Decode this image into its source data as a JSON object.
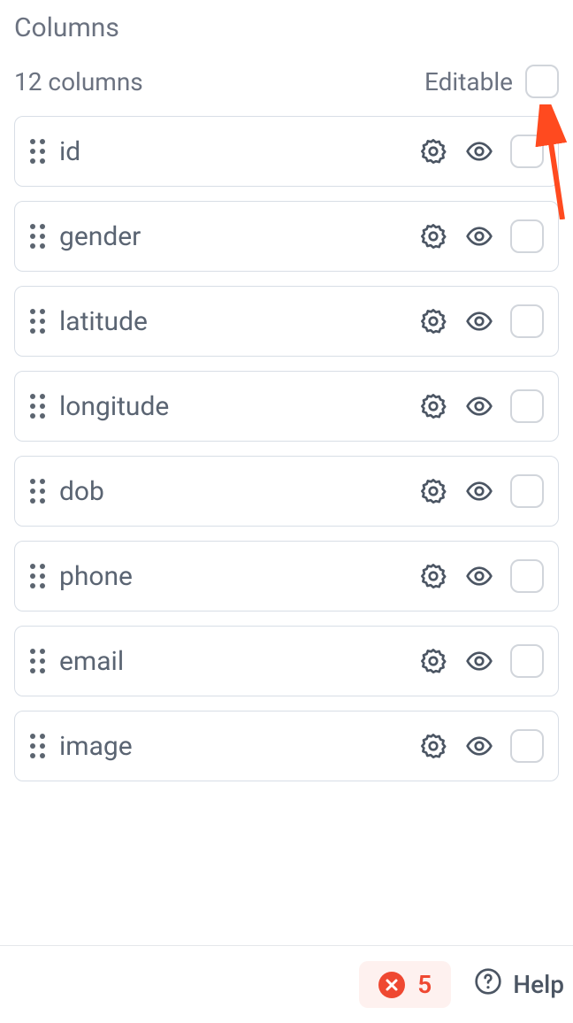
{
  "header": {
    "title": "Columns",
    "count_label": "12 columns",
    "editable_label": "Editable"
  },
  "columns": [
    {
      "name": "id"
    },
    {
      "name": "gender"
    },
    {
      "name": "latitude"
    },
    {
      "name": "longitude"
    },
    {
      "name": "dob"
    },
    {
      "name": "phone"
    },
    {
      "name": "email"
    },
    {
      "name": "image"
    }
  ],
  "footer": {
    "error_count": "5",
    "help_label": "Help"
  }
}
